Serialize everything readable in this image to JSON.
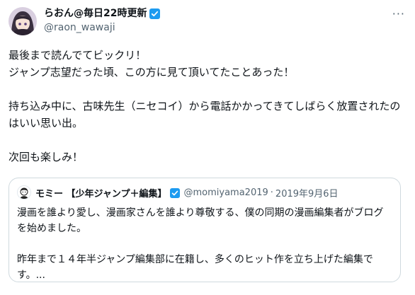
{
  "author": {
    "display_name": "らおん@毎日22時更新",
    "handle": "@raon_wawaji",
    "verified_color": "#1d9bf0"
  },
  "more_label": "···",
  "tweet": {
    "text": "最後まで読んでてビックリ！\nジャンプ志望だった頃、この方に見て頂いてたことあった！\n\n持ち込み中に、古味先生（ニセコイ）から電話かかってきてしばらく放置されたのはいい思い出。\n\n次回も楽しみ！"
  },
  "quoted_tweet": {
    "display_name": "モミー 【少年ジャンプ＋編集】",
    "handle": "@momiyama2019",
    "separator": "·",
    "date": "2019年9月6日",
    "text": "漫画を誰より愛し、漫画家さんを誰より尊敬する、僕の同期の漫画編集者がブログを始めました。\n\n昨年まで１４年半ジャンプ編集部に在籍し、多くのヒット作を立ち上げた編集です。..."
  }
}
